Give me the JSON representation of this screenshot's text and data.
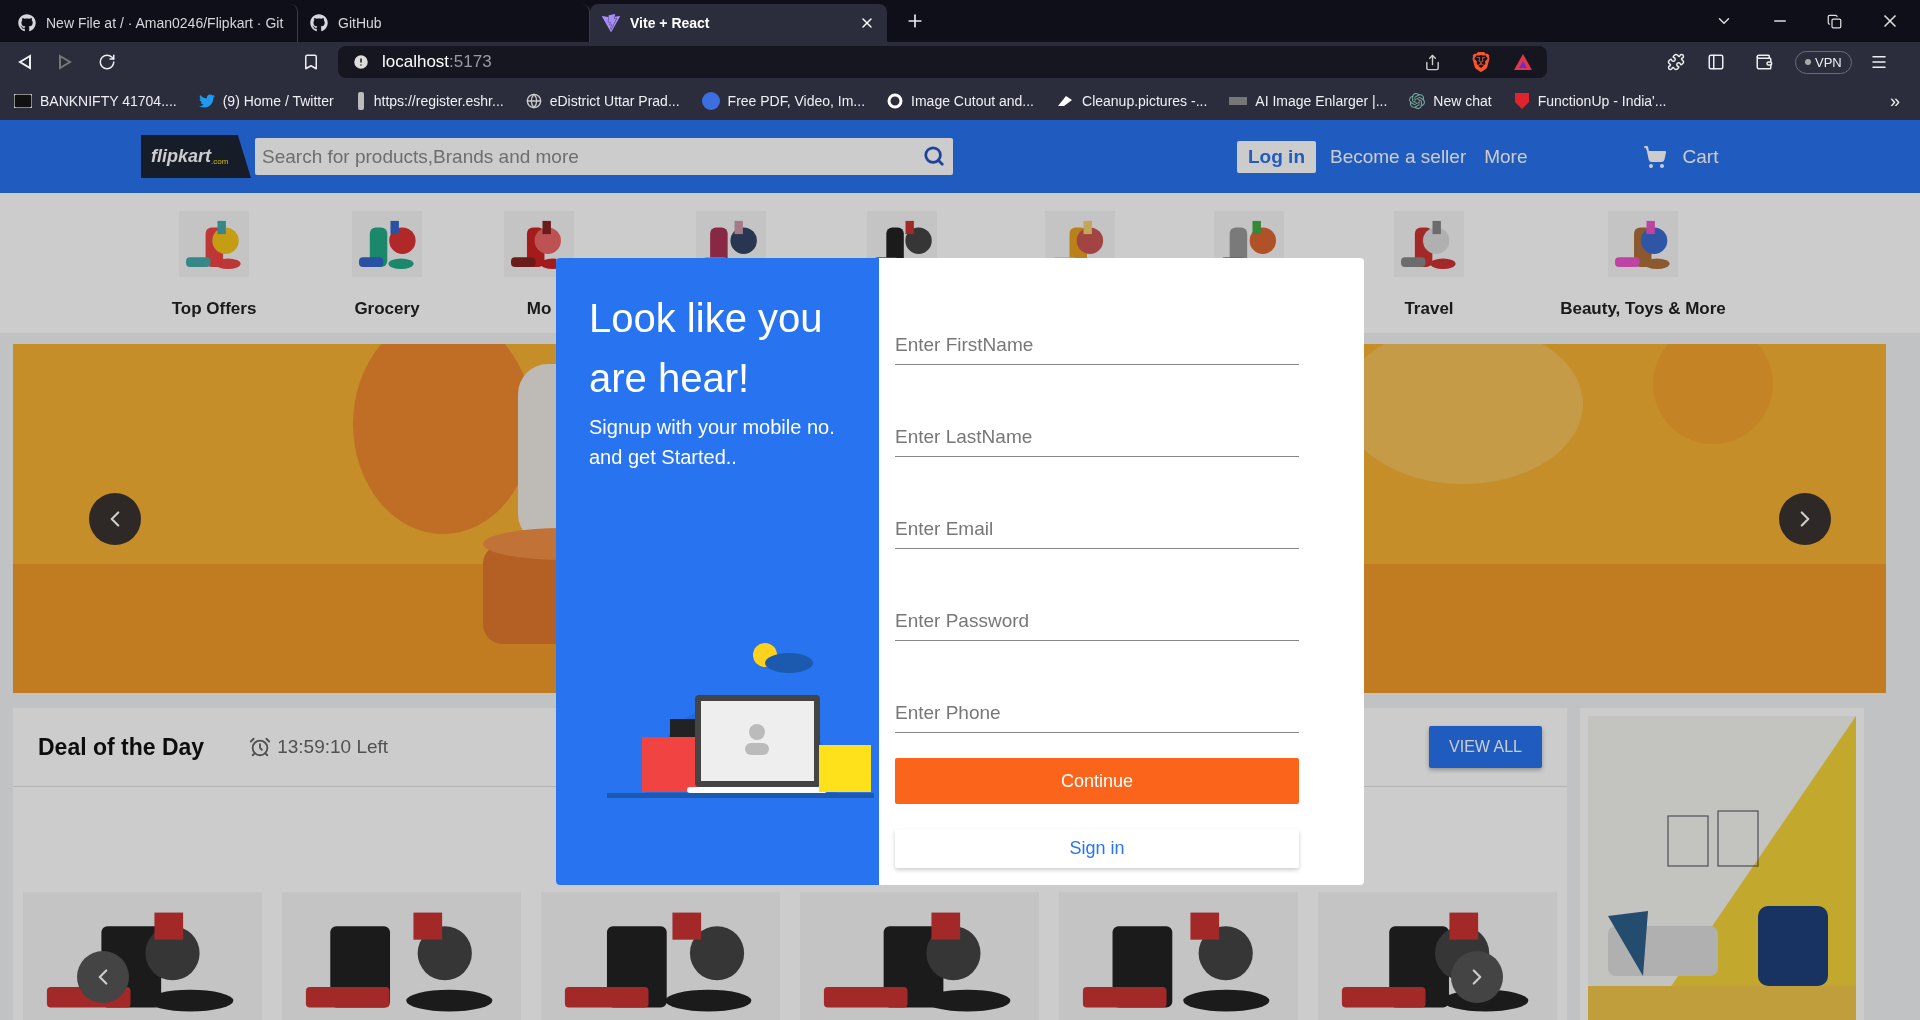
{
  "browser": {
    "tabs": [
      {
        "title": "New File at / · Aman0246/Flipkart · Git",
        "selected": false
      },
      {
        "title": "GitHub",
        "selected": false
      },
      {
        "title": "Vite + React",
        "selected": true
      }
    ],
    "url": {
      "host": "localhost",
      "port": ":5173"
    },
    "vpn": "VPN",
    "bookmarks": [
      "BANKNIFTY 41704....",
      "(9) Home / Twitter",
      "https://register.eshr...",
      "eDistrict Uttar Prad...",
      "Free PDF, Video, Im...",
      "Image Cutout and...",
      "Cleanup.pictures -...",
      "AI Image Enlarger |...",
      "New chat",
      "FunctionUp - India'..."
    ],
    "bookmarks_more": "»"
  },
  "header": {
    "logo": {
      "text": "flipkart",
      "suffix": ".com"
    },
    "search": {
      "placeholder": "Search for products,Brands and more"
    },
    "login": "Log in",
    "seller": "Become a seller",
    "more": "More",
    "cart": "Cart"
  },
  "categories": [
    {
      "kind": "picture",
      "label": "Top Offers"
    },
    {
      "kind": "picture",
      "label": "Grocery"
    },
    {
      "kind": "picture",
      "label": "Mo"
    },
    {
      "kind": "picture"
    },
    {
      "kind": "picture"
    },
    {
      "kind": "picture"
    },
    {
      "kind": "picture"
    },
    {
      "kind": "picture",
      "label": "Travel"
    },
    {
      "kind": "picture",
      "label": "Beauty, Toys & More"
    }
  ],
  "deal": {
    "title": "Deal of the Day",
    "timer": "13:59:10 Left",
    "button": "VIEW ALL",
    "products": [
      {
        "kind": "picture"
      },
      {
        "kind": "picture"
      },
      {
        "kind": "picture"
      },
      {
        "kind": "picture"
      },
      {
        "kind": "picture"
      },
      {
        "kind": "picture"
      }
    ]
  },
  "modal": {
    "heading": "Look like you are hear!",
    "subtitle": "Signup with your mobile no. and get Started..",
    "fields": [
      {
        "placeholder": "Enter FirstName"
      },
      {
        "placeholder": "Enter LastName"
      },
      {
        "placeholder": "Enter Email"
      },
      {
        "placeholder": "Enter Password"
      },
      {
        "placeholder": "Enter Phone"
      }
    ],
    "continue": "Continue",
    "signin": "Sign in"
  }
}
